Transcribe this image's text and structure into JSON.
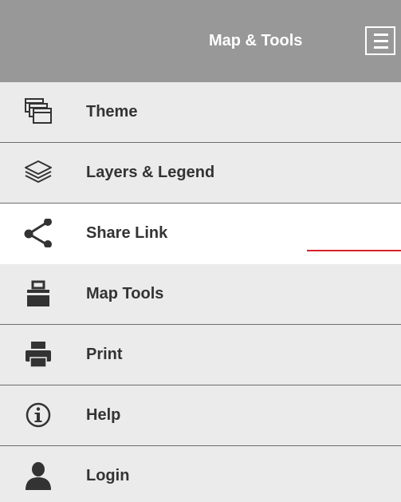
{
  "header": {
    "title": "Map & Tools",
    "menu_icon": "hamburger-icon"
  },
  "menu": {
    "active_index": 2,
    "items": [
      {
        "label": "Theme",
        "icon": "theme-icon"
      },
      {
        "label": "Layers & Legend",
        "icon": "layers-icon"
      },
      {
        "label": "Share Link",
        "icon": "share-icon"
      },
      {
        "label": "Map Tools",
        "icon": "toolbox-icon"
      },
      {
        "label": "Print",
        "icon": "printer-icon"
      },
      {
        "label": "Help",
        "icon": "info-icon"
      },
      {
        "label": "Login",
        "icon": "user-icon"
      }
    ]
  },
  "colors": {
    "header_bg": "#989898",
    "item_bg": "#ebebeb",
    "active_bg": "#ffffff",
    "divider": "#6e6e6e",
    "text": "#333333",
    "accent_line": "#d9202a"
  }
}
